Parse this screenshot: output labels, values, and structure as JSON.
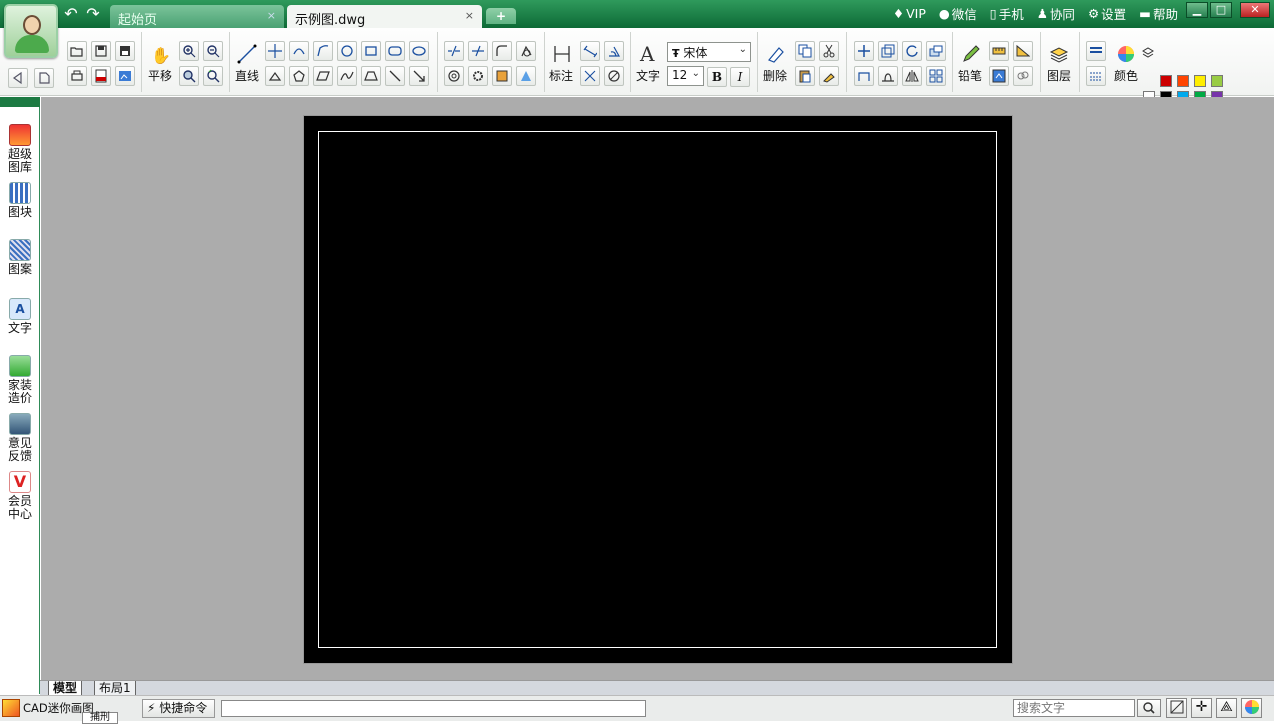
{
  "titlebar": {
    "tabs": [
      {
        "label": "起始页",
        "close": "×"
      },
      {
        "label": "示例图.dwg",
        "close": "×"
      }
    ],
    "add_tab": "+",
    "links": [
      {
        "label": "VIP",
        "icon": "diamond-icon"
      },
      {
        "label": "微信",
        "icon": "wechat-icon"
      },
      {
        "label": "手机",
        "icon": "phone-icon"
      },
      {
        "label": "协同",
        "icon": "collab-icon"
      },
      {
        "label": "设置",
        "icon": "gear-icon"
      },
      {
        "label": "帮助",
        "icon": "help-icon"
      }
    ],
    "colors": {
      "bar_top": "#2f9a5c",
      "bar_bottom": "#0d6a36"
    }
  },
  "toolbar": {
    "pan_label": "平移",
    "line_label": "直线",
    "dimension_label": "标注",
    "text_label": "文字",
    "font_name": "宋体",
    "font_size": "12",
    "bold": "B",
    "italic": "I",
    "delete_label": "删除",
    "pencil_label": "铅笔",
    "layer_label": "图层",
    "color_label": "颜色",
    "swatches": [
      "#cc0000",
      "#ff4400",
      "#ffee00",
      "#99cc44",
      "#ffffff",
      "#000000",
      "#00aaee",
      "#00aa44",
      "#7733aa"
    ]
  },
  "sidebar": {
    "items": [
      {
        "label": "超级\n图库",
        "icon": "gallery-icon"
      },
      {
        "label": "图块",
        "icon": "blocks-icon"
      },
      {
        "label": "图案",
        "icon": "hatch-icon"
      },
      {
        "label": "文字",
        "icon": "text-icon"
      },
      {
        "label": "家装\n造价",
        "icon": "home-cost-icon"
      },
      {
        "label": "意见\n反馈",
        "icon": "feedback-icon"
      },
      {
        "label": "会员\n中心",
        "icon": "vip-icon"
      }
    ]
  },
  "layout_tabs": [
    "模型",
    "布局1"
  ],
  "statusbar": {
    "brand": "CAD迷你画图",
    "tooltip": "捕刑",
    "quick_command": "快捷命令",
    "command_value": "",
    "search_placeholder": "搜索文字"
  }
}
